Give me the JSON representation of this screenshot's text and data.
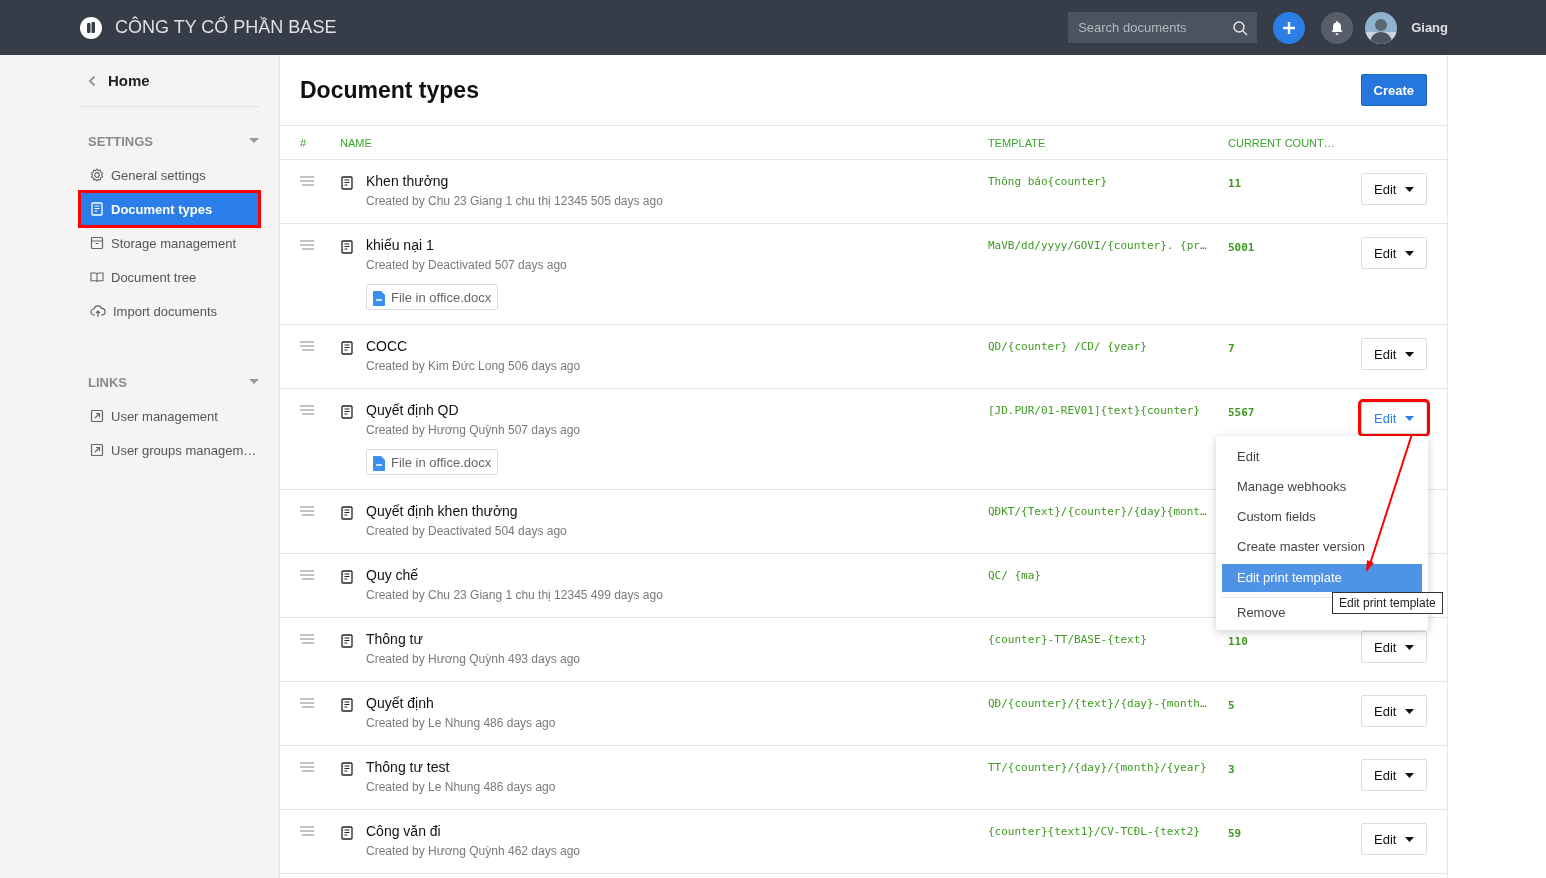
{
  "header": {
    "company": "CÔNG TY CỔ PHẦN BASE",
    "search": {
      "placeholder": "Search documents"
    },
    "user": "Giang"
  },
  "sidebar": {
    "back": "Home",
    "sections": [
      {
        "title": "SETTINGS",
        "items": [
          {
            "label": "General settings",
            "selected": false,
            "annotated": false
          },
          {
            "label": "Document types",
            "selected": true,
            "annotated": true
          },
          {
            "label": "Storage management",
            "selected": false,
            "annotated": false
          },
          {
            "label": "Document tree",
            "selected": false,
            "annotated": false
          },
          {
            "label": "Import documents",
            "selected": false,
            "annotated": false
          }
        ]
      },
      {
        "title": "LINKS",
        "items": [
          {
            "label": "User management",
            "selected": false,
            "annotated": false
          },
          {
            "label": "User groups managem…",
            "selected": false,
            "annotated": false
          }
        ]
      }
    ]
  },
  "page": {
    "title": "Document types",
    "create_button": "Create"
  },
  "columns": [
    "#",
    "NAME",
    "TEMPLATE",
    "CURRENT COUNT…"
  ],
  "rows": [
    {
      "name": "Khen thưởng",
      "meta": "Created by Chu 23 Giang 1 chu thị 12345 505 days ago",
      "template": "Thông báo{counter}",
      "count": "11",
      "action": {
        "label": "Edit",
        "open": false,
        "annotated": false
      }
    },
    {
      "name": "khiếu nại 1",
      "meta": "Created by Deactivated 507 days ago",
      "file": "File in office.docx",
      "template": "MaVB/dd/yyyy/GOVI/{counter}. {pr…",
      "count": "5001",
      "action": {
        "label": "Edit",
        "open": false,
        "annotated": false
      }
    },
    {
      "name": "COCC",
      "meta": "Created by Kim Đức Long 506 days ago",
      "template": "QD/{counter} /CD/ {year}",
      "count": "7",
      "action": {
        "label": "Edit",
        "open": false,
        "annotated": false
      }
    },
    {
      "name": "Quyết định QD",
      "meta": "Created by Hương Quỳnh 507 days ago",
      "file": "File in office.docx",
      "template": "[JD.PUR/01-REV01]{text}{counter}",
      "count": "5567",
      "action": {
        "label": "Edit",
        "open": true,
        "annotated": true
      },
      "menu": {
        "items": [
          {
            "label": "Edit",
            "selected": false,
            "divider_before": false
          },
          {
            "label": "Manage webhooks",
            "selected": false,
            "divider_before": false
          },
          {
            "label": "Custom fields",
            "selected": false,
            "divider_before": false
          },
          {
            "label": "Create master version",
            "selected": false,
            "divider_before": false
          },
          {
            "label": "Edit print template",
            "selected": true,
            "divider_before": false,
            "tooltip": "Edit print template"
          },
          {
            "label": "Remove",
            "selected": false,
            "divider_before": true
          }
        ]
      }
    },
    {
      "name": "Quyết định khen thưởng",
      "meta": "Created by Deactivated 504 days ago",
      "template": "QĐKT/{Text}/{counter}/{day}{mont…"
    },
    {
      "name": "Quy chế",
      "meta": "Created by Chu 23 Giang 1 chu thị 12345 499 days ago",
      "template": "QC/ {ma}"
    },
    {
      "name": "Thông tư",
      "meta": "Created by Hương Quỳnh 493 days ago",
      "template": "{counter}-TT/BASE-{text}",
      "count": "110",
      "action": {
        "label": "Edit",
        "open": false,
        "annotated": false
      }
    },
    {
      "name": "Quyết định",
      "meta": "Created by Le Nhung 486 days ago",
      "template": "QĐ/{counter}/{text}/{day}-{month…",
      "count": "5",
      "action": {
        "label": "Edit",
        "open": false,
        "annotated": false
      }
    },
    {
      "name": "Thông tư test",
      "meta": "Created by Le Nhung 486 days ago",
      "template": "TT/{counter}/{day}/{month}/{year}",
      "count": "3",
      "action": {
        "label": "Edit",
        "open": false,
        "annotated": false
      }
    },
    {
      "name": "Công văn đi",
      "meta": "Created by Hương Quỳnh 462 days ago",
      "template": "{counter}{text1}/CV-TCĐL-{text2}",
      "count": "59",
      "action": {
        "label": "Edit",
        "open": false,
        "annotated": false
      }
    }
  ]
}
